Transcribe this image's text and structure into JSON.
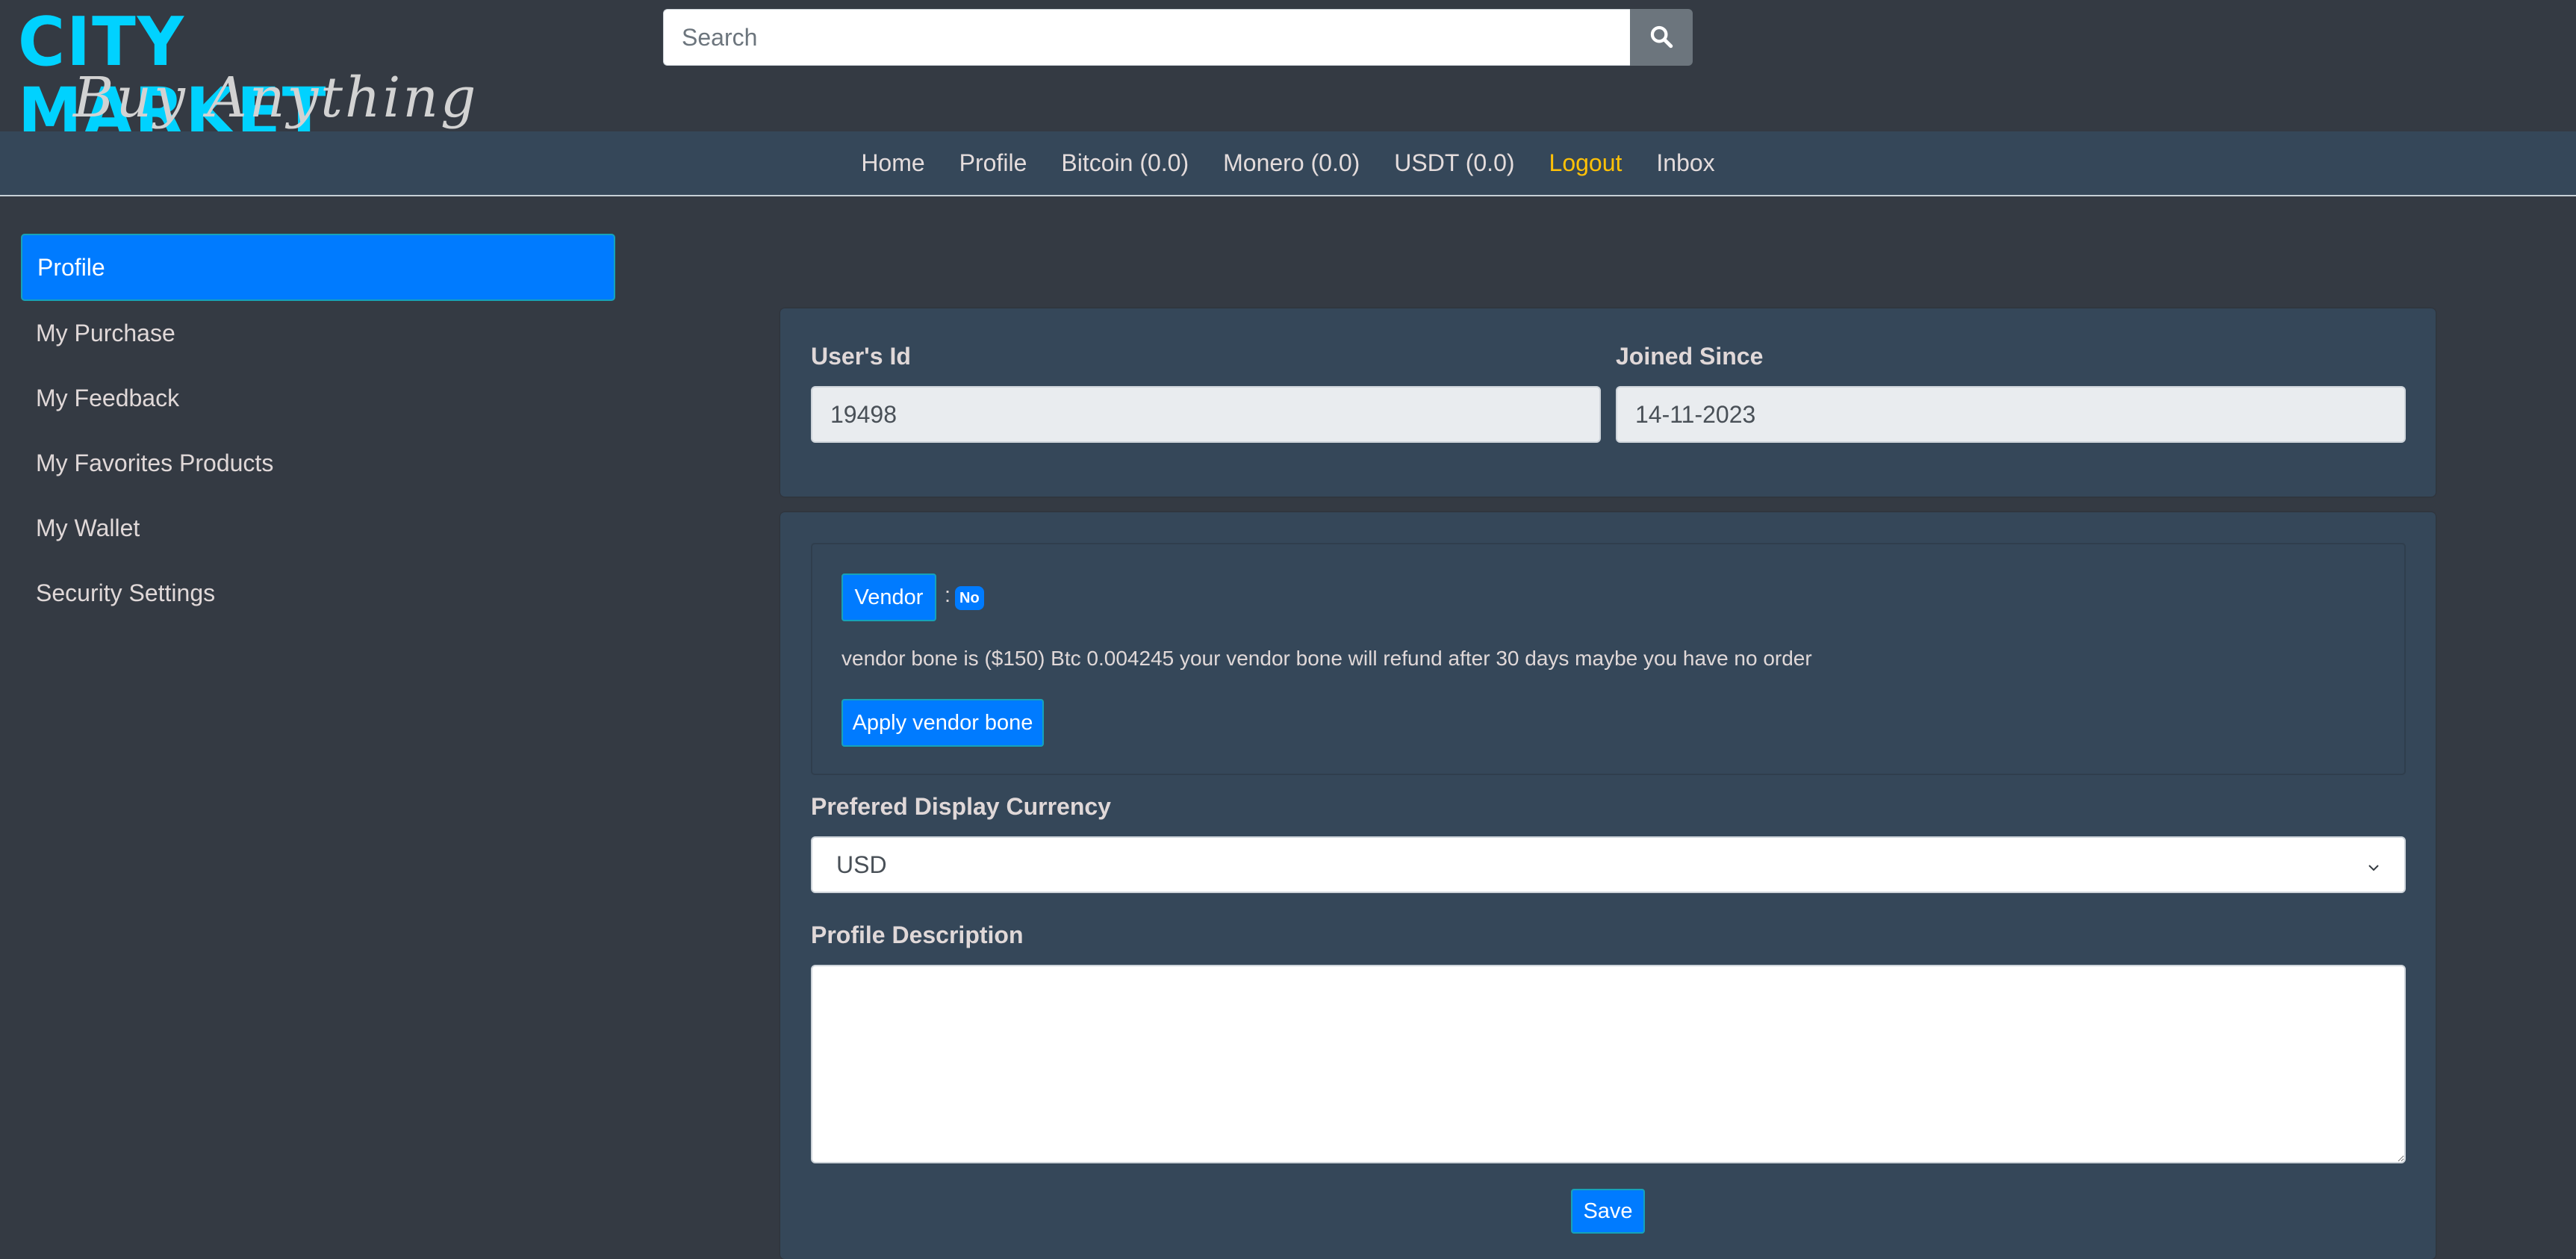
{
  "header": {
    "logo_title": "CITY MARKET",
    "logo_subtitle": "Buy Anything",
    "search": {
      "placeholder": "Search",
      "value": "",
      "button_icon": "search-icon"
    }
  },
  "nav": {
    "items": [
      {
        "label": "Home"
      },
      {
        "label": "Profile"
      },
      {
        "label": "Bitcoin (0.0)"
      },
      {
        "label": "Monero (0.0)"
      },
      {
        "label": "USDT (0.0)"
      },
      {
        "label": "Logout",
        "color": "#ffc107"
      },
      {
        "label": "Inbox"
      }
    ]
  },
  "sidebar": {
    "items": [
      {
        "label": "Profile",
        "active": true
      },
      {
        "label": "My Purchase"
      },
      {
        "label": "My Feedback"
      },
      {
        "label": "My Favorites Products"
      },
      {
        "label": "My Wallet"
      },
      {
        "label": "Security Settings"
      }
    ]
  },
  "account": {
    "user_id_label": "User's Id",
    "user_id_value": "19498",
    "joined_label": "Joined Since",
    "joined_value": "14-11-2023"
  },
  "vendor": {
    "button_label": "Vendor",
    "separator": ":",
    "status_badge": "No",
    "info_text": "vendor bone is ($150) Btc 0.004245 your vendor bone will refund after 30 days maybe you have no order",
    "apply_button_label": "Apply vendor bone"
  },
  "settings": {
    "currency_label": "Prefered Display Currency",
    "currency_selected": "USD",
    "description_label": "Profile Description",
    "description_value": "",
    "save_label": "Save"
  },
  "colors": {
    "background": "#343a43",
    "panel": "#354759",
    "primary": "#007bff",
    "logo_accent": "#00d2ff",
    "logout": "#ffc107"
  }
}
